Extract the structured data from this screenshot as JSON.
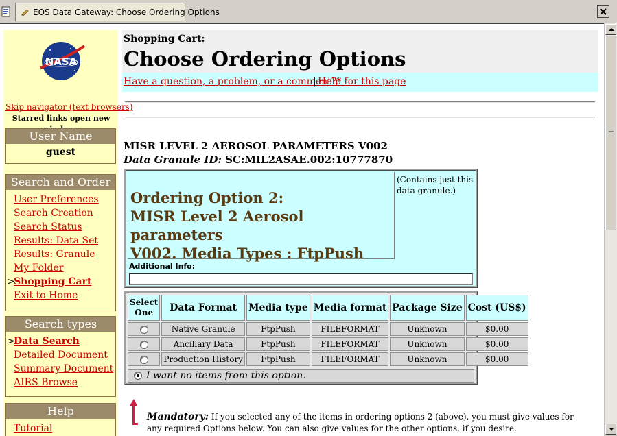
{
  "browser": {
    "tab_title": "EOS Data Gateway: Choose Ordering Options"
  },
  "nav": {
    "logo_text": "NASA",
    "skip_link": "Skip navigator (text browsers)",
    "starred_note": "Starred links open new windows",
    "user_section": {
      "heading": "User Name",
      "value": "guest"
    },
    "search_order": {
      "heading": "Search and Order",
      "items": [
        {
          "label": "User Preferences"
        },
        {
          "label": "Search Creation"
        },
        {
          "label": "Search Status"
        },
        {
          "label": "Results: Data Set"
        },
        {
          "label": "Results: Granule"
        },
        {
          "label": "My Folder"
        },
        {
          "label": "Shopping Cart",
          "current": true
        },
        {
          "label": "Exit to Home"
        }
      ]
    },
    "search_types": {
      "heading": "Search types",
      "items": [
        {
          "label": "Data Search",
          "current": true
        },
        {
          "label": "Detailed Document"
        },
        {
          "label": "Summary Document"
        },
        {
          "label": "AIRS Browse"
        }
      ]
    },
    "help_section": {
      "heading": "Help",
      "items": [
        {
          "label": "Tutorial"
        }
      ]
    },
    "current_marker": ">"
  },
  "main": {
    "subtitle": "Shopping Cart:",
    "title": "Choose Ordering Options",
    "question_link": "Have a question, a problem, or a comment?*",
    "separator": "|",
    "help_link": "Help for this page",
    "dataset_name": "MISR LEVEL 2 AEROSOL PARAMETERS V002",
    "granule_label": "Data Granule ID:",
    "granule_id": "SC:MIL2ASAE.002:10777870",
    "option": {
      "title_line1": "Ordering Option 2:",
      "title_line2": "MISR Level 2 Aerosol parameters",
      "title_line3": "V002. Media Types : FtpPush",
      "note": "(Contains just this data granule.)",
      "additional_info_label": "Additional Info:",
      "additional_info_value": ""
    },
    "table": {
      "headers": {
        "select_line1": "Select",
        "select_line2": "One",
        "format": "Data Format",
        "media_type": "Media type",
        "media_format": "Media format",
        "package_size": "Package Size",
        "cost": "Cost (US$)"
      },
      "rows": [
        {
          "format": "Native Granule",
          "media_type": "FtpPush",
          "media_format": "FILEFORMAT",
          "package_size": "Unknown",
          "cost": "$0.00",
          "selected": false
        },
        {
          "format": "Ancillary Data",
          "media_type": "FtpPush",
          "media_format": "FILEFORMAT",
          "package_size": "Unknown",
          "cost": "$0.00",
          "selected": false
        },
        {
          "format": "Production History",
          "media_type": "FtpPush",
          "media_format": "FILEFORMAT",
          "package_size": "Unknown",
          "cost": "$0.00",
          "selected": false
        }
      ],
      "no_items_label": "I want no items from this option.",
      "no_items_selected": true
    },
    "mandatory_label": "Mandatory:",
    "mandatory_text": "If you selected any of the items in ordering options 2 (above), you must give values for any required Options below. You can also give values for the other options, if you desire."
  },
  "colors": {
    "nav_bg": "#ffffc0",
    "nav_heading_bg": "#9c8b6a",
    "link": "#cc0000",
    "cyan_panel": "#ccffff",
    "option_title": "#5a3a10",
    "header_bg": "#efefef"
  },
  "icons": [
    "document-icon",
    "tab-page-icon",
    "close-icon",
    "nasa-logo",
    "scroll-up-icon",
    "scroll-down-icon",
    "mandatory-arrow-icon"
  ]
}
